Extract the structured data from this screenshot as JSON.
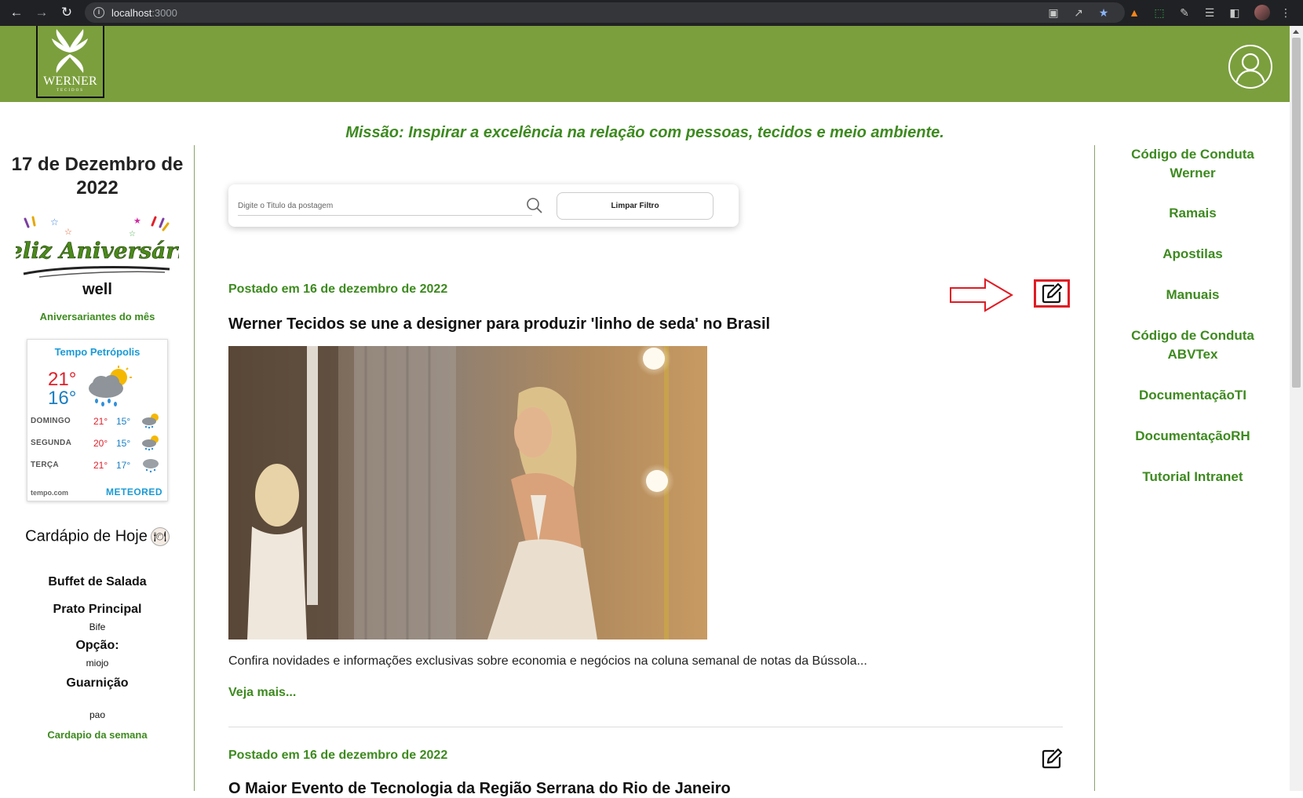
{
  "browser": {
    "url_host": "localhost",
    "url_port": ":3000"
  },
  "header": {
    "logo_text": "WERNER",
    "logo_sub": "TECIDOS"
  },
  "mission": "Missão: Inspirar a excelência na relação com pessoas, tecidos e meio ambiente.",
  "left": {
    "date_line1": "17 de Dezembro de",
    "date_line2": "2022",
    "birthday_name": "well",
    "birthday_link": "Aniversariantes do mês",
    "weather": {
      "title": "Tempo Petrópolis",
      "high": "21°",
      "low": "16°",
      "days": [
        {
          "day": "DOMINGO",
          "hi": "21°",
          "lo": "15°"
        },
        {
          "day": "SEGUNDA",
          "hi": "20°",
          "lo": "15°"
        },
        {
          "day": "TERÇA",
          "hi": "21°",
          "lo": "17°"
        }
      ],
      "source": "tempo.com",
      "brand": "METEORED"
    },
    "menu": {
      "title": "Cardápio de Hoje",
      "salad": "Buffet de Salada",
      "main_label": "Prato Principal",
      "main_value": "Bife",
      "option_label": "Opção:",
      "option_value": "miojo",
      "side_label": "Guarnição",
      "side_value": "pao",
      "week_link": "Cardapio da semana"
    }
  },
  "right_links": [
    "Código de Conduta Werner",
    "Ramais",
    "Apostilas",
    "Manuais",
    "Código de Conduta ABVTex",
    "DocumentaçãoTI",
    "DocumentaçãoRH",
    "Tutorial Intranet"
  ],
  "search": {
    "placeholder": "Digite o Titulo da postagem",
    "clear_label": "Limpar Filtro"
  },
  "posts": [
    {
      "date": "Postado em 16 de dezembro de 2022",
      "title": "Werner Tecidos se une a designer para produzir 'linho de seda' no Brasil",
      "summary": "Confira novidades e informações exclusivas sobre economia e negócios na coluna semanal de notas da Bússola...",
      "read_more": "Veja mais..."
    },
    {
      "date": "Postado em 16 de dezembro de 2022",
      "title": "O Maior Evento de Tecnologia da Região Serrana do Rio de Janeiro"
    }
  ],
  "colors": {
    "header_green": "#7b9f3d",
    "link_green": "#3d8a1f",
    "annotation_red": "#e01b24"
  }
}
